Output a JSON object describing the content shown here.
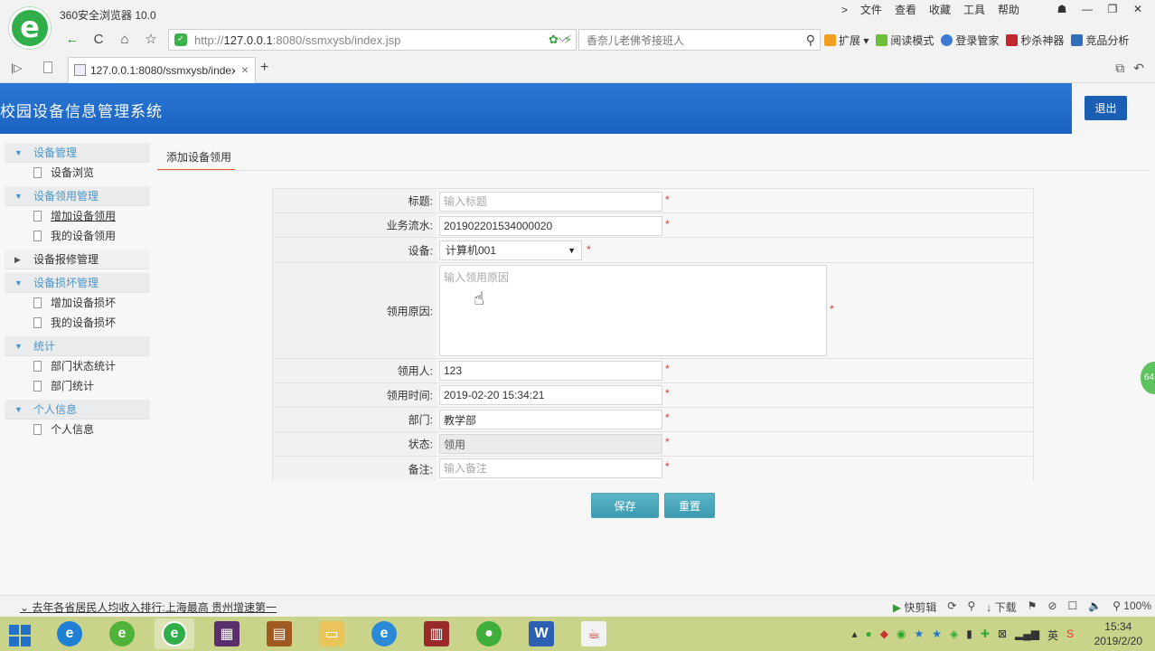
{
  "browser": {
    "title": "360安全浏览器 10.0",
    "logo_glyph": "e",
    "menu": [
      "文件",
      "查看",
      "收藏",
      "工具",
      "帮助"
    ],
    "url_prefix": "http://",
    "url_host": "127.0.0.1",
    "url_rest": ":8080/ssmxysb/index.jsp",
    "search_placeholder": "香奈儿老佛爷接班人",
    "extensions": [
      {
        "label": "扩展",
        "color": "#f0a020"
      },
      {
        "label": "阅读模式",
        "color": "#6bbf3b"
      },
      {
        "label": "登录管家",
        "color": "#3b7bd4"
      },
      {
        "label": "秒杀神器",
        "color": "#c0282d"
      },
      {
        "label": "竞品分析",
        "color": "#2e6fb8"
      }
    ],
    "tab_title": "127.0.0.1:8080/ssmxysb/index.jsp",
    "icons": {
      "back": "←",
      "reload": "C",
      "home": "⌂",
      "star": "☆",
      "search": "⚲",
      "close": "×",
      "new_tab": "+"
    }
  },
  "app": {
    "title": "校园设备信息管理系统",
    "logout_label": "退出"
  },
  "sidebar": {
    "groups": [
      {
        "label": "设备管理",
        "open": true,
        "items": [
          "设备浏览"
        ]
      },
      {
        "label": "设备领用管理",
        "open": true,
        "items": [
          "增加设备领用",
          "我的设备领用"
        ]
      },
      {
        "label": "设备报修管理",
        "open": false,
        "items": []
      },
      {
        "label": "设备损坏管理",
        "open": true,
        "items": [
          "增加设备损坏",
          "我的设备损坏"
        ]
      },
      {
        "label": "统计",
        "open": true,
        "items": [
          "部门状态统计",
          "部门统计"
        ]
      },
      {
        "label": "个人信息",
        "open": true,
        "items": [
          "个人信息"
        ]
      }
    ]
  },
  "main": {
    "tab_label": "添加设备领用",
    "form": {
      "title": {
        "label": "标题:",
        "value": "",
        "placeholder": "输入标题"
      },
      "serial": {
        "label": "业务流水:",
        "value": "201902201534000020"
      },
      "device": {
        "label": "设备:",
        "value": "计算机001"
      },
      "reason": {
        "label": "领用原因:",
        "value": "",
        "placeholder": "输入领用原因"
      },
      "recipient": {
        "label": "领用人:",
        "value": "123"
      },
      "time": {
        "label": "领用时间:",
        "value": "2019-02-20 15:34:21"
      },
      "department": {
        "label": "部门:",
        "value": "教学部"
      },
      "status": {
        "label": "状态:",
        "value": "领用"
      },
      "remark": {
        "label": "备注:",
        "value": "",
        "placeholder": "输入备注"
      },
      "required_mark": "*"
    },
    "save_label": "保存",
    "reset_label": "重置"
  },
  "statusbar": {
    "news": "去年各省居民人均收入排行:上海最高 贵州增速第一",
    "right": [
      "快剪辑",
      "下载",
      "100%"
    ]
  },
  "taskbar": {
    "time": "15:34",
    "date": "2019/2/20",
    "ime": "英"
  }
}
